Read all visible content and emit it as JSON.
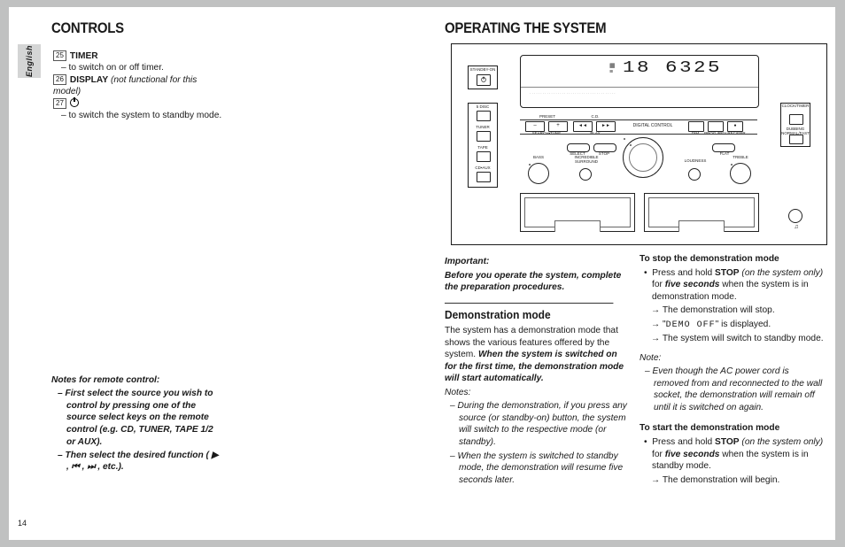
{
  "lang_tab": "English",
  "page_number": "14",
  "left": {
    "heading": "CONTROLS",
    "items": [
      {
        "num": "25",
        "title": "TIMER",
        "desc": "– to switch on or off timer."
      },
      {
        "num": "26",
        "title": "DISPLAY",
        "note_italic": " (not functional for this model)"
      },
      {
        "num": "27",
        "desc": "– to switch the system to standby mode."
      }
    ],
    "remote_notes": {
      "title": "Notes for remote control:",
      "line1": "– First select the source you wish to control by pressing one of the source select keys on the remote control (e.g. CD, TUNER, TAPE 1/2 or AUX).",
      "line2": "– Then select the desired function ( ▶ , ⏮ , ⏭ , etc.)."
    }
  },
  "mid": {
    "heading": "OPERATING THE SYSTEM",
    "important_label": "Important:",
    "important_text": "Before you operate the system, complete the preparation procedures.",
    "demo_heading": "Demonstration mode",
    "demo_intro": "The system has a demonstration mode that shows the various features offered by the system. ",
    "demo_bold": "When the system is switched on for the first time, the demonstration mode will start automatically.",
    "notes_label": "Notes:",
    "note1": "– During the demonstration, if you press any source (or standby-on) button, the system will switch to the respective mode (or standby).",
    "note2": "– When the system is switched to standby mode, the demonstration will resume five seconds later."
  },
  "right": {
    "stop_title": "To stop the demonstration mode",
    "stop_b1a": "Press and hold ",
    "stop_b1_bold": "STOP",
    "stop_b1b_italic": " (on the system only) ",
    "stop_b1c": "for ",
    "stop_b1_bold2": "five seconds",
    "stop_b1d": " when the system is in demonstration mode.",
    "stop_a1": "→ The demonstration will stop.",
    "stop_a2a": "→ \"",
    "stop_a2_dotted": "DEMO OFF",
    "stop_a2b": "\" is displayed.",
    "stop_a3": "→ The system will switch to standby mode.",
    "note_label": "Note:",
    "note_text": "– Even though the AC power cord is removed from and reconnected to the wall socket, the demonstration will remain off until it is switched on again.",
    "start_title": "To start the demonstration mode",
    "start_b1a": "Press and hold ",
    "start_b1_bold": "STOP",
    "start_b1b_italic": " (on the system only) ",
    "start_b1c": "for ",
    "start_b1_bold2": "five seconds",
    "start_b1d": " when the system is in standby mode.",
    "start_a1": "→ The demonstration will begin."
  },
  "diagram": {
    "lcd_digits": "18  6325",
    "left_labels": [
      "STANDBY-ON",
      "5 DISC",
      "TUNER",
      "TAPE",
      "CD•AUX"
    ],
    "right_labels": [
      "CLOCK/TIMER",
      "DUBBING NORMAL/FAST"
    ],
    "mid_labels": {
      "preset": "PRESET",
      "cd": "C.D.",
      "digital_control": "DIGITAL CONTROL",
      "searchtune": "SEARCH•TUNE",
      "play": "PLAY",
      "dim": "DIM",
      "progrev": "PROG./REV.",
      "recerr": "REC/ERR",
      "bass": "BASS",
      "treble": "TREBLE",
      "incredible": "INCREDIBLE SURROUND",
      "loudness": "LOUDNESS",
      "select": "SELECT",
      "stop": "STOP",
      "flat": "FLAT"
    }
  }
}
